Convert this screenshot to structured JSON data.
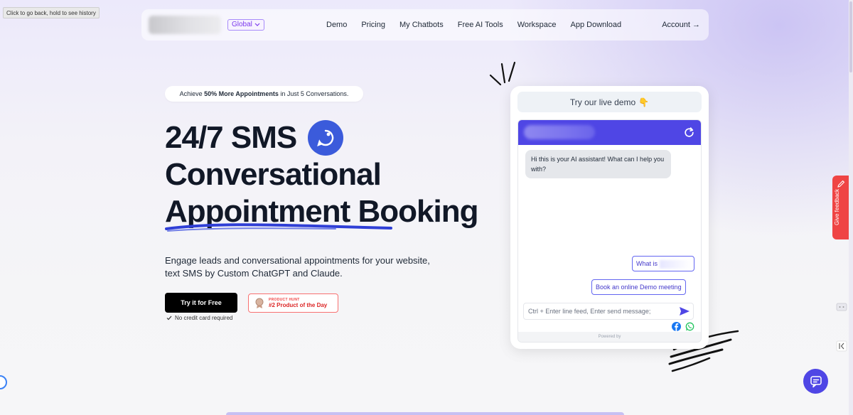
{
  "browser": {
    "back_tooltip": "Click to go back, hold to see history"
  },
  "nav": {
    "region": "Global",
    "links": [
      "Demo",
      "Pricing",
      "My Chatbots",
      "Free AI Tools",
      "Workspace",
      "App Download"
    ],
    "account": "Account →"
  },
  "hero": {
    "pill_prefix": "Achieve ",
    "pill_bold": "50% More Appointments",
    "pill_suffix": " in Just 5 Conversations.",
    "headline": [
      "24/7 SMS",
      "Conversational",
      "Appointment Booking"
    ],
    "subtext": "Engage leads and conversational appointments for your website, text SMS by Custom ChatGPT and Claude.",
    "cta": "Try it for Free",
    "no_card": "No credit card required",
    "ph_small": "PRODUCT HUNT",
    "ph_big": "#2 Product of the Day"
  },
  "demo": {
    "header": "Try our live demo",
    "header_emoji": "👇",
    "greeting": "Hi this is your AI assistant! What can I help you with?",
    "suggestions": [
      "What is",
      "Book an online Demo meeting"
    ],
    "input_placeholder": "Ctrl + Enter line feed, Enter send message;",
    "powered": "Powered by"
  },
  "side": {
    "feedback": "Give feedback"
  },
  "colors": {
    "accent": "#4f46e5",
    "brand_blue": "#3b5bdb",
    "feedback_red": "#ef4444",
    "region_purple": "#7c3aed"
  },
  "icons": {
    "region": "chevron-down-icon",
    "brand": "chat-bubble-icon",
    "refresh": "refresh-icon",
    "send": "send-icon",
    "facebook": "facebook-icon",
    "whatsapp": "whatsapp-icon",
    "feedback": "pencil-icon",
    "fab": "chat-icon"
  }
}
